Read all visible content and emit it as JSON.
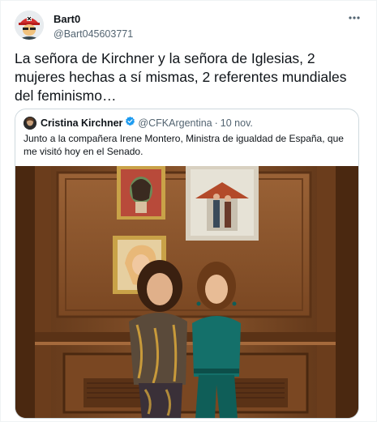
{
  "tweet": {
    "author_name": "Bart0",
    "author_handle": "@Bart045603771",
    "text": "La señora de Kirchner y la señora de Iglesias, 2 mujeres hechas a sí mismas, 2 referentes mundiales del feminismo…",
    "more_icon": "more-horizontal-icon"
  },
  "quoted": {
    "author_name": "Cristina Kirchner",
    "verified_icon": "verified-badge-icon",
    "author_handle": "@CFKArgentina",
    "separator": "·",
    "date": "10 nov.",
    "text": "Junto a la compañera Irene Montero, Ministra de igualdad de España, que me visitó hoy en el Senado."
  },
  "colors": {
    "text_primary": "#0f1419",
    "text_secondary": "#536471",
    "border": "#cfd9de",
    "verified_blue": "#1d9bf0",
    "wood_panel": "#7a4a28"
  }
}
